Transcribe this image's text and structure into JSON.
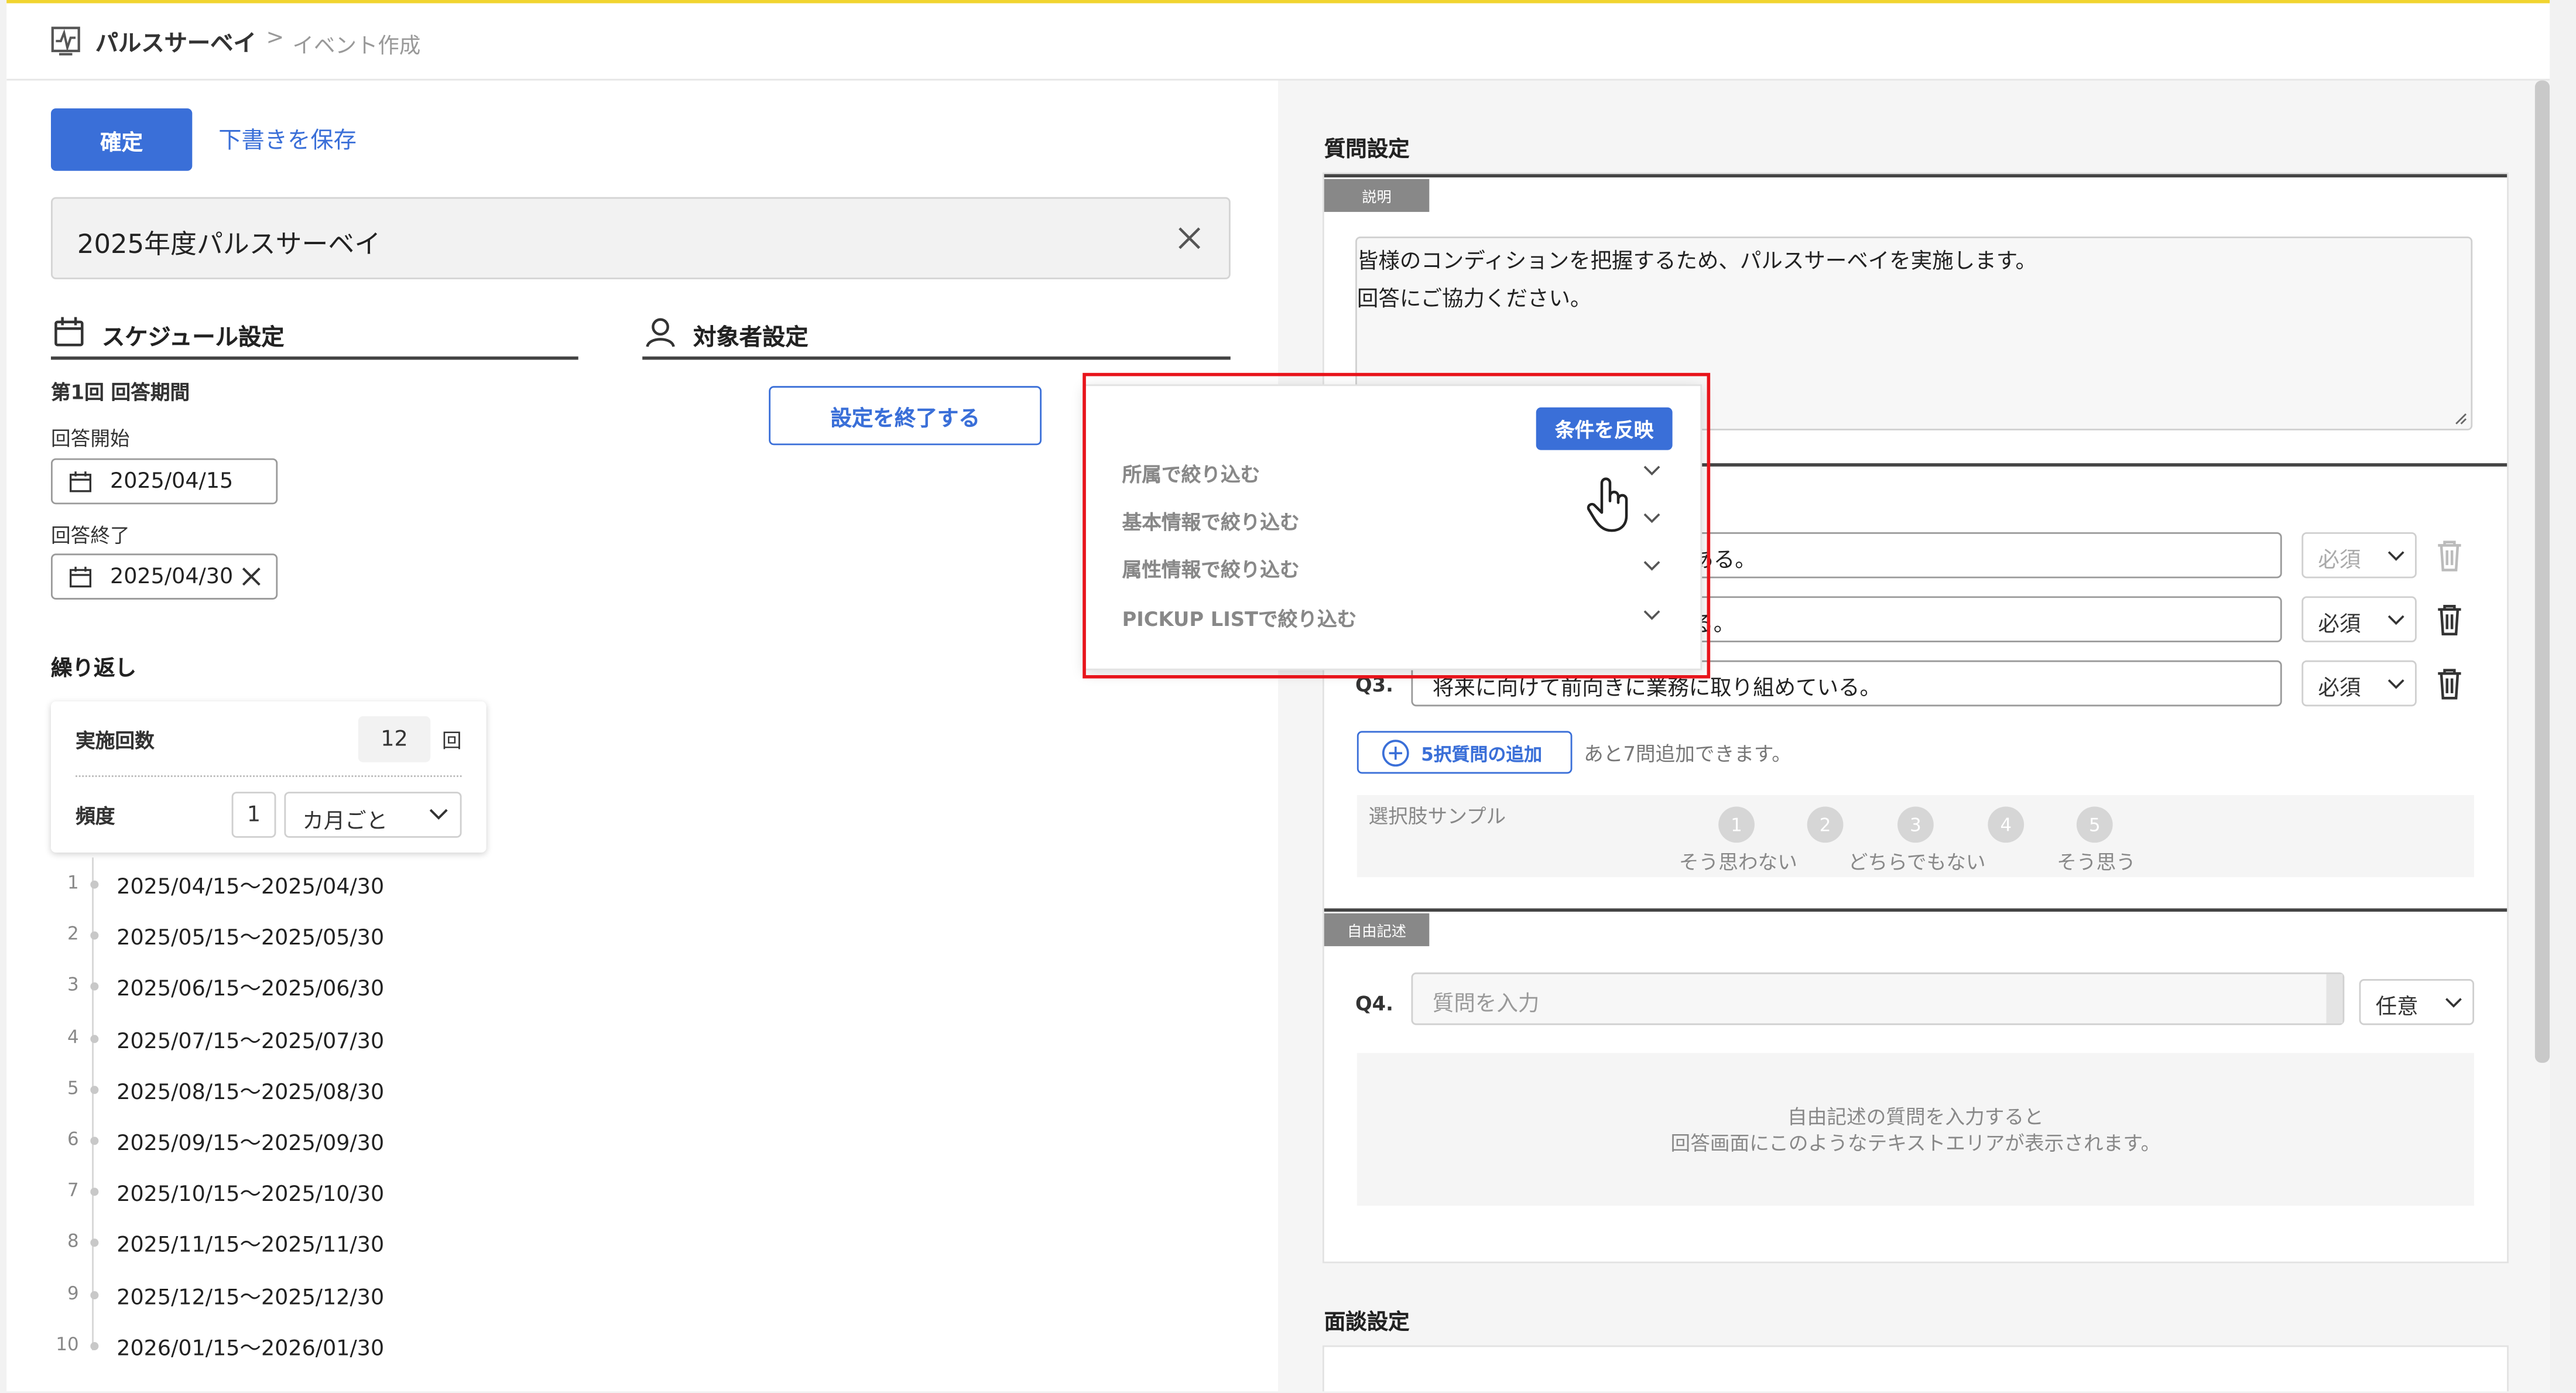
{
  "breadcrumb": {
    "app": "パルスサーベイ",
    "separator": ">",
    "current": "イベント作成"
  },
  "actions": {
    "confirm": "確定",
    "save_draft": "下書きを保存"
  },
  "event_title": "2025年度パルスサーベイ",
  "schedule": {
    "heading": "スケジュール設定",
    "period_label": "第1回 回答期間",
    "start_label": "回答開始",
    "start_value": "2025/04/15",
    "end_label": "回答終了",
    "end_value": "2025/04/30",
    "repeat_heading": "繰り返し",
    "count_label": "実施回数",
    "count_value": "12",
    "count_unit": "回",
    "freq_label": "頻度",
    "freq_value": "1",
    "freq_unit": "カ月ごと",
    "periods": [
      {
        "n": "1",
        "range": "2025/04/15～2025/04/30"
      },
      {
        "n": "2",
        "range": "2025/05/15～2025/05/30"
      },
      {
        "n": "3",
        "range": "2025/06/15～2025/06/30"
      },
      {
        "n": "4",
        "range": "2025/07/15～2025/07/30"
      },
      {
        "n": "5",
        "range": "2025/08/15～2025/08/30"
      },
      {
        "n": "6",
        "range": "2025/09/15～2025/09/30"
      },
      {
        "n": "7",
        "range": "2025/10/15～2025/10/30"
      },
      {
        "n": "8",
        "range": "2025/11/15～2025/11/30"
      },
      {
        "n": "9",
        "range": "2025/12/15～2025/12/30"
      },
      {
        "n": "10",
        "range": "2026/01/15～2026/01/30"
      }
    ]
  },
  "target": {
    "heading": "対象者設定",
    "end_settings_button": "設定を終了する",
    "popover": {
      "apply_button": "条件を反映",
      "filters": [
        "所属で絞り込む",
        "基本情報で絞り込む",
        "属性情報で絞り込む",
        "PICKUP LISTで絞り込む"
      ]
    }
  },
  "questions": {
    "heading": "質問設定",
    "description_tag": "説明",
    "description_line1": "皆様のコンディションを把握するため、パルスサーベイを実施します。",
    "description_line2": "回答にご協力ください。",
    "items": [
      {
        "text": "ある。",
        "req": "必須"
      },
      {
        "text": "る。",
        "req": "必須"
      },
      {
        "label": "Q3.",
        "text": "将来に向けて前向きに業務に取り組めている。",
        "req": "必須"
      }
    ],
    "add_button": "5択質問の追加",
    "remaining": "あと7問追加できます。",
    "sample_label": "選択肢サンプル",
    "scale": [
      "1",
      "2",
      "3",
      "4",
      "5"
    ],
    "scale_labels": [
      "そう思わない",
      "どちらでもない",
      "そう思う"
    ],
    "free_tag": "自由記述",
    "q4_label": "Q4.",
    "q4_placeholder": "質問を入力",
    "q4_req": "任意",
    "free_note_line1": "自由記述の質問を入力すると",
    "free_note_line2": "回答画面にこのようなテキストエリアが表示されます。"
  },
  "interview": {
    "heading": "面談設定"
  },
  "colors": {
    "primary": "#3a6fd8",
    "highlight": "#e8141b",
    "top_accent": "#f1d42f"
  }
}
